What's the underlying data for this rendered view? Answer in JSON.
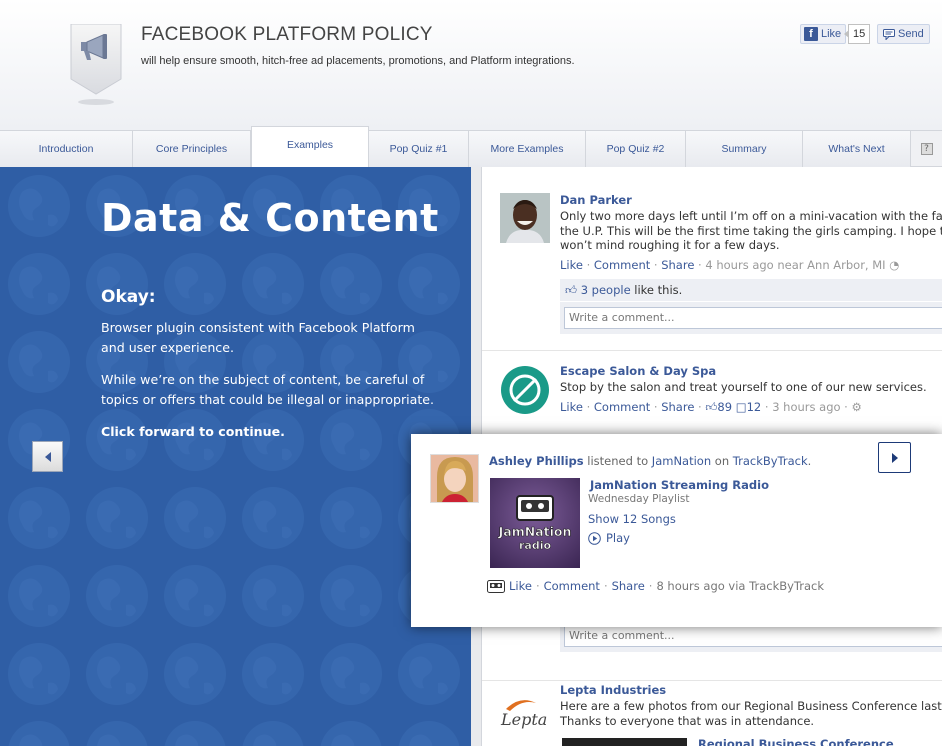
{
  "header": {
    "title": "FACEBOOK PLATFORM POLICY",
    "subtitle": "will help ensure smooth, hitch-free ad placements, promotions, and Platform integrations.",
    "like_label": "Like",
    "like_count": "15",
    "send_label": "Send",
    "badge_icon": "megaphone-icon"
  },
  "tabs": [
    {
      "label": "Introduction"
    },
    {
      "label": "Core Principles"
    },
    {
      "label": "Examples",
      "active": true
    },
    {
      "label": "Pop Quiz #1"
    },
    {
      "label": "More Examples"
    },
    {
      "label": "Pop Quiz #2"
    },
    {
      "label": "Summary"
    },
    {
      "label": "What's Next"
    }
  ],
  "help_label": "?",
  "panel": {
    "heading": "Data & Content",
    "subheading": "Okay:",
    "paragraph1": "Browser plugin consistent with Facebook Platform and user experience.",
    "paragraph2": "While we’re on the subject of content, be careful of topics or offers that could be illegal or inappropriate.",
    "paragraph3": "Click forward to continue.",
    "background_color": "#2f5ea5"
  },
  "feed": {
    "story1": {
      "name": "Dan Parker",
      "line1": "Only two more days left until I’m off on a mini-vacation with the family",
      "line2": "the U.P. This will be the first time taking the girls camping. I hope they",
      "line3": "won’t mind roughing it for a few days.",
      "like": "Like",
      "comment": "Comment",
      "share": "Share",
      "meta": "4 hours ago near Ann Arbor, MI",
      "likes_count": "3 people",
      "likes_suffix": " like this.",
      "comment_placeholder": "Write a comment..."
    },
    "story2": {
      "name": "Escape Salon & Day Spa",
      "line1": "Stop by the salon and treat yourself to one of our new services.",
      "like": "Like",
      "comment": "Comment",
      "share": "Share",
      "likes": "89",
      "comments": "12",
      "meta": "3 hours ago"
    },
    "story3_comment_placeholder": "Write a comment...",
    "story4": {
      "name": "Lepta Industries",
      "logo_text": "Lepta",
      "line1": "Here are a few photos from our Regional Business Conference last week",
      "line2": "Thanks to everyone that was in attendance.",
      "album_title": "Regional Business Conference"
    }
  },
  "popup": {
    "user": "Ashley Phillips",
    "verb": " listened to ",
    "artist": "JamNation",
    "on": " on ",
    "app": "TrackByTrack",
    "period": ".",
    "station_title": "JamNation Streaming Radio",
    "station_sub": "Wednesday Playlist",
    "show_songs": "Show 12 Songs",
    "play": "Play",
    "art_line1": "JamNation",
    "art_line2": "radio",
    "like": "Like",
    "comment": "Comment",
    "share": "Share",
    "meta": "8 hours ago via TrackByTrack"
  }
}
